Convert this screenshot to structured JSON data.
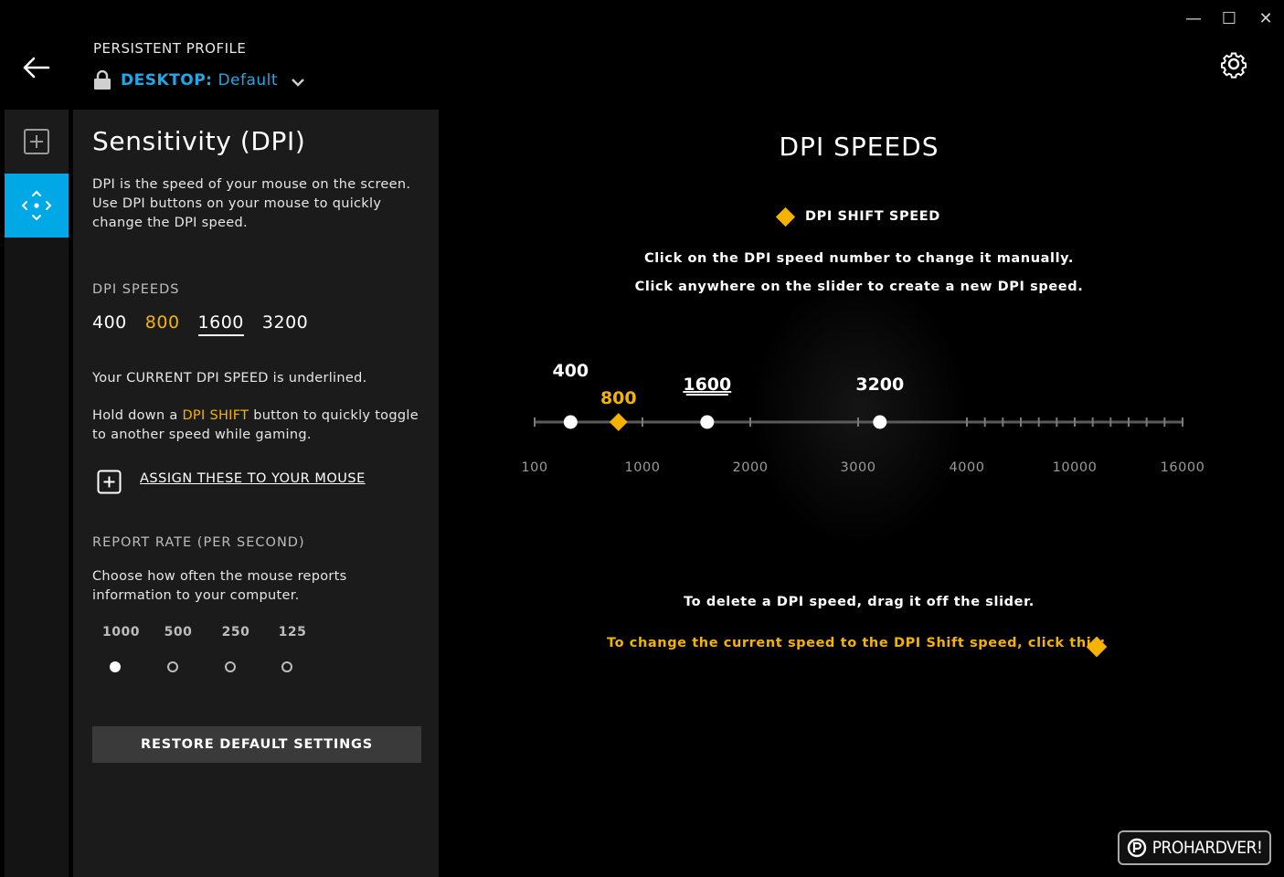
{
  "window": {
    "minimize_glyph": "—",
    "maximize_glyph": "☐",
    "close_glyph": "✕"
  },
  "header": {
    "profile_caption": "PERSISTENT PROFILE",
    "profile_device": "DESKTOP:",
    "profile_name": "Default",
    "icons": [
      "back-arrow-icon",
      "lock-icon",
      "chevron-down-icon",
      "gear-icon"
    ]
  },
  "panel": {
    "title": "Sensitivity (DPI)",
    "description": "DPI is the speed of your mouse on the screen. Use DPI buttons on your mouse to quickly change the DPI speed.",
    "dpi_heading": "DPI SPEEDS",
    "dpi_values": [
      "400",
      "800",
      "1600",
      "3200"
    ],
    "current_note": "Your CURRENT DPI SPEED is underlined.",
    "shift_pre": "Hold down a ",
    "shift_word": "DPI SHIFT",
    "shift_post": " button to quickly toggle to another speed while gaming.",
    "assign_label": "ASSIGN THESE TO YOUR MOUSE",
    "report_heading": "REPORT RATE (PER SECOND)",
    "report_desc": "Choose how often the mouse reports information to your computer.",
    "report_rates": [
      "1000",
      "500",
      "250",
      "125"
    ],
    "report_selected": "1000",
    "restore_label": "RESTORE DEFAULT SETTINGS"
  },
  "main": {
    "title": "DPI SPEEDS",
    "legend": "DPI SHIFT SPEED",
    "instruction_1": "Click on the DPI speed number to change it manually.",
    "instruction_2": "Click anywhere on the slider to create a new DPI speed.",
    "delete_note": "To delete a DPI speed, drag it off the slider.",
    "shift_note": "To change the current speed to the DPI Shift speed, click this:"
  },
  "slider": {
    "axis_labels": [
      "100",
      "1000",
      "2000",
      "3000",
      "4000",
      "10000",
      "16000"
    ],
    "points": [
      {
        "label": "400",
        "value": 400,
        "kind": "normal"
      },
      {
        "label": "800",
        "value": 800,
        "kind": "shift"
      },
      {
        "label": "1600",
        "value": 1600,
        "kind": "current"
      },
      {
        "label": "3200",
        "value": 3200,
        "kind": "normal"
      }
    ]
  },
  "colors": {
    "accent_blue": "#00a9e6",
    "shift_yellow": "#f5b300",
    "panel_bg": "#1b1b1b"
  },
  "watermark": {
    "text": "PROHARDVER!"
  }
}
